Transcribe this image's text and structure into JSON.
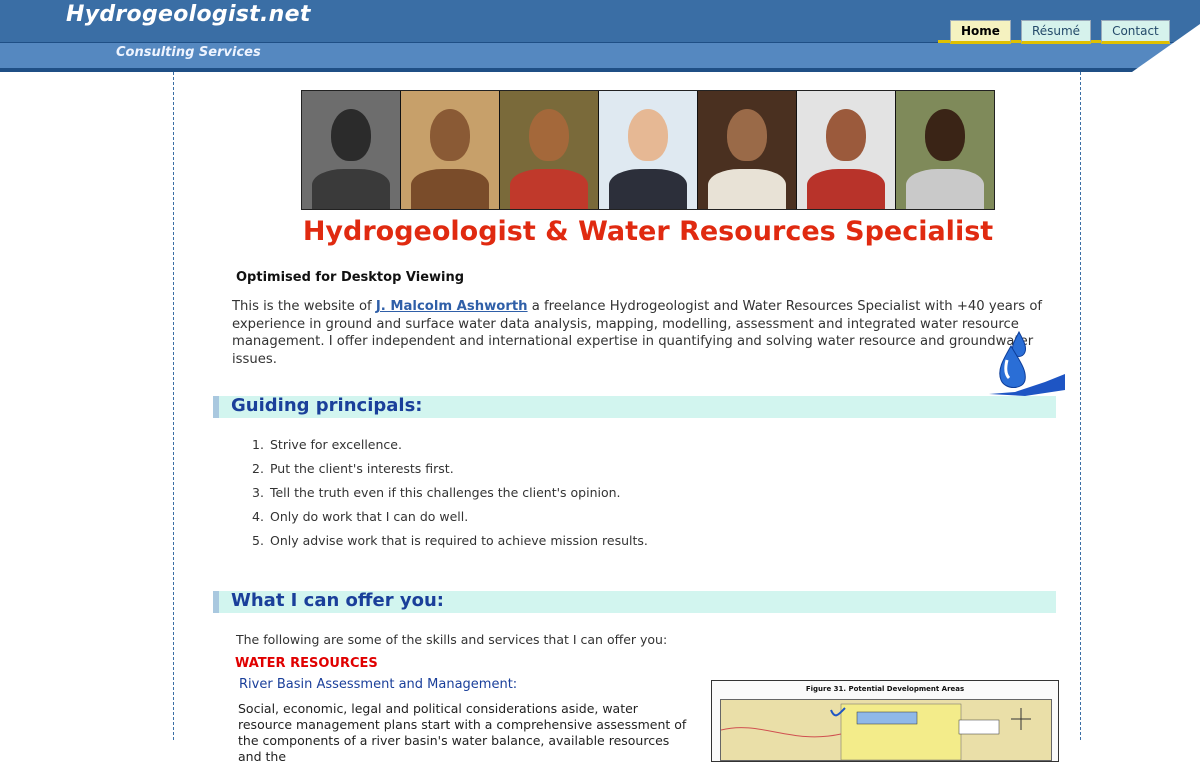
{
  "header": {
    "site_title": "Hydrogeologist.net",
    "tagline": "Consulting Services",
    "nav": [
      {
        "label": "Home",
        "active": true
      },
      {
        "label": "Résumé",
        "active": false
      },
      {
        "label": "Contact",
        "active": false
      }
    ]
  },
  "banner": {
    "portraits": [
      "portrait-1",
      "portrait-2",
      "portrait-3",
      "portrait-4",
      "portrait-5",
      "portrait-6",
      "portrait-7"
    ]
  },
  "main": {
    "title": "Hydrogeologist & Water Resources Specialist",
    "optimised_note": "Optimised for Desktop Viewing",
    "intro_prefix": "This is the website of ",
    "intro_link": "J. Malcolm Ashworth",
    "intro_suffix": " a freelance Hydrogeologist and Water Resources Specialist with +40 years of experience in ground and surface water data analysis, mapping, modelling, assessment and integrated water resource management. I offer independent and international expertise in quantifying and solving water resource and groundwater issues."
  },
  "principles": {
    "heading": "Guiding principals:",
    "items": [
      "Strive for excellence.",
      "Put the client's interests first.",
      "Tell the truth even if this challenges the client's opinion.",
      "Only do work that I can do well.",
      "Only advise work that is required to achieve mission results."
    ]
  },
  "offer": {
    "heading": "What I can offer you:",
    "intro": "The following are some of the skills and services that I can offer you:",
    "category": "WATER RESOURCES",
    "subheading": "River Basin Assessment and Management:",
    "paragraph": "Social, economic, legal and political considerations aside, water resource management plans start with a comprehensive assessment of the components of a river basin's water balance, available resources and the",
    "figure_title": "Figure 31. Potential Development Areas"
  },
  "colors": {
    "header_blue": "#3a6ea5",
    "title_red": "#e02a10",
    "section_bg": "#d2f5ef",
    "section_text": "#1a3f9a"
  }
}
